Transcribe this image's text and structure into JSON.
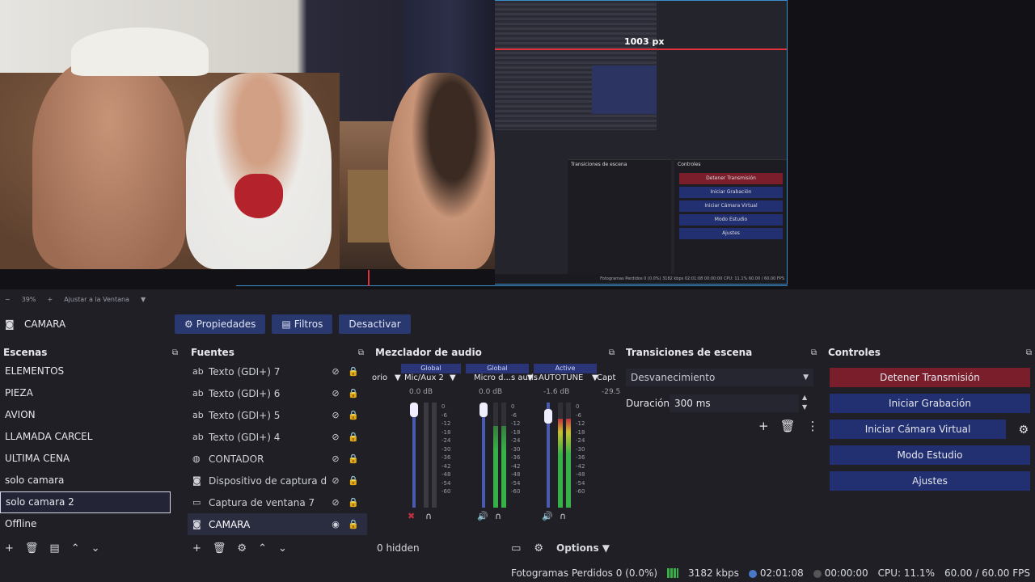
{
  "preview": {
    "measure_label": "1003 px",
    "zoom_value": "39%",
    "fit_label": "Ajustar a la Ventana",
    "nested": {
      "panel_transitions": "Transiciones de escena",
      "panel_controls": "Controles",
      "buttons": [
        "Detener Transmisión",
        "Iniciar Grabación",
        "Iniciar Cámara Virtual",
        "Modo Estudio",
        "Ajustes"
      ],
      "status": "Fotogramas Perdidos 0 (0.0%)   3182 kbps   02:01:08   00:00:00   CPU: 11.1%   60.00 / 60.00 FPS"
    }
  },
  "context": {
    "source_name": "CAMARA",
    "properties_label": "Propiedades",
    "filters_label": "Filtros",
    "deactivate_label": "Desactivar"
  },
  "scenes": {
    "title": "Escenas",
    "items": [
      "ELEMENTOS",
      "PIEZA",
      "AVION",
      "LLAMADA CARCEL",
      "ULTIMA CENA",
      "solo camara",
      "solo camara 2",
      "Offline"
    ],
    "selected_index": 6
  },
  "sources": {
    "title": "Fuentes",
    "items": [
      {
        "name": "Texto (GDI+) 7",
        "icon": "text-icon"
      },
      {
        "name": "Texto (GDI+) 6",
        "icon": "text-icon"
      },
      {
        "name": "Texto (GDI+) 5",
        "icon": "text-icon"
      },
      {
        "name": "Texto (GDI+) 4",
        "icon": "text-icon"
      },
      {
        "name": "CONTADOR",
        "icon": "browser-icon"
      },
      {
        "name": "Dispositivo de captura de",
        "icon": "camera-icon"
      },
      {
        "name": "Captura de ventana 7",
        "icon": "window-icon"
      },
      {
        "name": "CAMARA",
        "icon": "camera-icon"
      }
    ],
    "selected_index": 7
  },
  "mixer": {
    "title": "Mezclador de audio",
    "tabs": [
      "Global",
      "Global",
      "Active"
    ],
    "channels": [
      {
        "name": "orio",
        "db": ""
      },
      {
        "name": "Mic/Aux 2",
        "db": "0.0 dB"
      },
      {
        "name": "Micro d...s auris",
        "db": "0.0 dB"
      },
      {
        "name": "AUTOTUNE",
        "db": "-1.6 dB"
      },
      {
        "name": "Capt",
        "db": "-29.5"
      }
    ],
    "ticks": [
      "0",
      "-6",
      "-12",
      "-18",
      "-24",
      "-30",
      "-36",
      "-42",
      "-48",
      "-54",
      "-60"
    ],
    "hidden_label": "0 hidden",
    "options_label": "Options"
  },
  "transitions": {
    "title": "Transiciones de escena",
    "selected": "Desvanecimiento",
    "duration_label": "Duración",
    "duration_value": "300 ms"
  },
  "controls": {
    "title": "Controles",
    "stop_stream": "Detener Transmisión",
    "start_record": "Iniciar Grabación",
    "virtual_cam": "Iniciar Cámara Virtual",
    "studio_mode": "Modo Estudio",
    "settings": "Ajustes"
  },
  "status": {
    "dropped_frames": "Fotogramas Perdidos 0 (0.0%)",
    "bitrate": "3182 kbps",
    "stream_time": "02:01:08",
    "record_time": "00:00:00",
    "cpu": "CPU: 11.1%",
    "fps": "60.00 / 60.00 FPS"
  },
  "colors": {
    "accent_blue": "#223072",
    "stop_red": "#7a1e2c",
    "meter_green": "#38b048"
  }
}
